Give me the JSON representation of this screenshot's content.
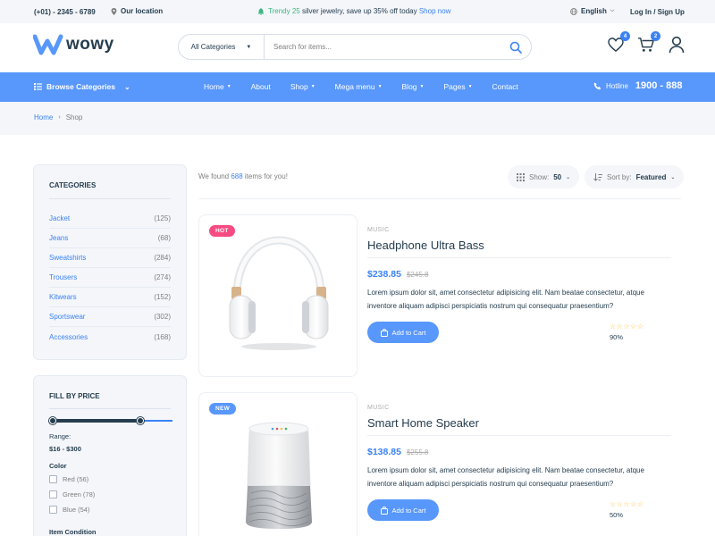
{
  "topbar": {
    "phone": "(+01) - 2345 - 6789",
    "location": "Our location",
    "promo_pre": "Trendy 25",
    "promo_mid": " silver jewelry, save up 35% off today ",
    "promo_link": "Shop now",
    "language": "English",
    "login": "Log In / Sign Up"
  },
  "header": {
    "logo": "wowy",
    "category_select": "All Categories",
    "search_placeholder": "Search for items...",
    "wishlist_count": "4",
    "cart_count": "2"
  },
  "nav": {
    "browse": "Browse Categories",
    "items": [
      {
        "label": "Home",
        "caret": true
      },
      {
        "label": "About",
        "caret": false
      },
      {
        "label": "Shop",
        "caret": true
      },
      {
        "label": "Mega menu",
        "caret": true
      },
      {
        "label": "Blog",
        "caret": true
      },
      {
        "label": "Pages",
        "caret": true
      },
      {
        "label": "Contact",
        "caret": false
      }
    ],
    "hotline_label": "Hotline",
    "hotline_number": "1900 - 888"
  },
  "breadcrumb": {
    "home": "Home",
    "current": "Shop"
  },
  "sidebar": {
    "categories_title": "CATEGORIES",
    "categories": [
      {
        "name": "Jacket",
        "count": "(125)"
      },
      {
        "name": "Jeans",
        "count": "(68)"
      },
      {
        "name": "Sweatshirts",
        "count": "(284)"
      },
      {
        "name": "Trousers",
        "count": "(274)"
      },
      {
        "name": "Kitwears",
        "count": "(152)"
      },
      {
        "name": "Sportswear",
        "count": "(302)"
      },
      {
        "name": "Accessories",
        "count": "(168)"
      }
    ],
    "price_title": "FILL BY PRICE",
    "range_label": "Range:",
    "range_value": "$16 - $300",
    "color_label": "Color",
    "colors": [
      {
        "label": "Red (56)"
      },
      {
        "label": "Green (78)"
      },
      {
        "label": "Blue (54)"
      }
    ],
    "condition_label": "Item Condition"
  },
  "toolbar": {
    "found_pre": "We found ",
    "found_count": "688",
    "found_post": " items for you!",
    "show_label": "Show:",
    "show_value": "50",
    "sort_label": "Sort by:",
    "sort_value": "Featured"
  },
  "products": [
    {
      "tag": "HOT",
      "category": "MUSIC",
      "title": "Headphone Ultra Bass",
      "price": "$238.85",
      "old_price": "$245.8",
      "description": "Lorem ipsum dolor sit, amet consectetur adipisicing elit. Nam beatae consectetur, atque inventore aliquam adipisci perspiciatis nostrum qui consequatur praesentium?",
      "button": "Add to Cart",
      "rating": "90%"
    },
    {
      "tag": "NEW",
      "category": "MUSIC",
      "title": "Smart Home Speaker",
      "price": "$138.85",
      "old_price": "$255.8",
      "description": "Lorem ipsum dolor sit, amet consectetur adipisicing elit. Nam beatae consectetur, atque inventore aliquam adipisci perspiciatis nostrum qui consequatur praesentium?",
      "button": "Add to Cart",
      "rating": "50%"
    }
  ],
  "colors": {
    "accent": "#5897fb",
    "link": "#3b82f6",
    "hot": "#f74b81",
    "star": "#fdc040",
    "text": "#253d4e"
  }
}
